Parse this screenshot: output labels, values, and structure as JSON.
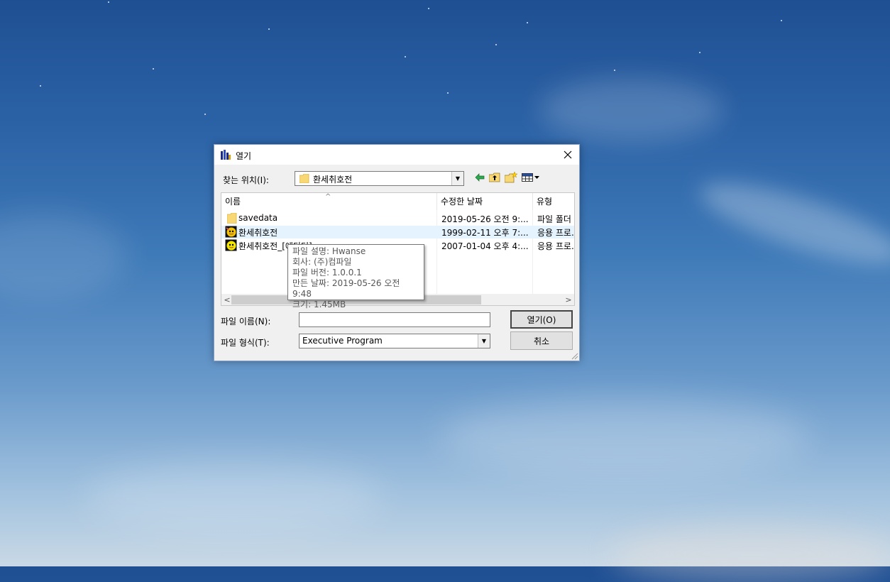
{
  "dialog": {
    "title": "열기",
    "look_in_label": "찾는 위치(I):",
    "look_in_value": "환세취호전",
    "toolbar_icons": [
      "back-arrow-icon",
      "up-folder-icon",
      "new-folder-icon",
      "view-menu-icon"
    ],
    "columns": [
      "이름",
      "수정한 날짜",
      "유형"
    ],
    "files": [
      {
        "name": "savedata",
        "date": "2019-05-26 오전 9:...",
        "type": "파일 폴더",
        "icon": "folder-icon"
      },
      {
        "name": "환세취호전",
        "date": "1999-02-11 오후 7:...",
        "type": "응용 프로...",
        "icon": "exe-icon"
      },
      {
        "name": "환세취호전_[에디터]",
        "date": "2007-01-04 오후 4:...",
        "type": "응용 프로...",
        "icon": "exe-icon"
      }
    ],
    "tooltip": [
      "파일 설명: Hwanse",
      "회사: (주)컴파일",
      "파일 버전: 1.0.0.1",
      "만든 날짜: 2019-05-26 오전 9:48",
      "크기: 1.45MB"
    ],
    "filename_label": "파일 이름(N):",
    "filename_value": "",
    "filetype_label": "파일 형식(T):",
    "filetype_value": "Executive Program",
    "open_button": "열기(O)",
    "cancel_button": "취소"
  },
  "colors": {
    "selection": "#e5f3ff",
    "dialog_bg": "#f0f0f0",
    "folder": "#f8d775"
  }
}
